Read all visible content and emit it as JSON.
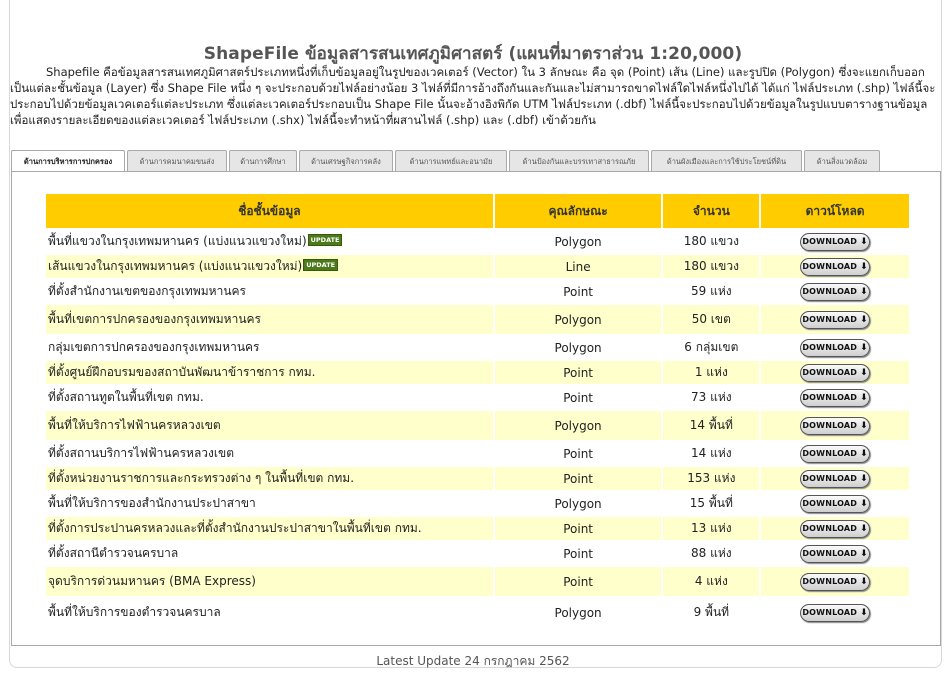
{
  "title": "ShapeFile ข้อมูลสารสนเทศภูมิศาสตร์ (แผนที่มาตราส่วน 1:20,000)",
  "intro": "Shapefile คือข้อมูลสารสนเทศภูมิศาสตร์ประเภทหนึ่งที่เก็บข้อมูลอยู่ในรูปของเวคเตอร์ (Vector) ใน 3 ลักษณะ คือ จุด (Point) เส้น (Line) และรูปปิด (Polygon) ซึ่งจะแยกเก็บออกเป็นแต่ละชั้นข้อมูล (Layer) ซึ่ง Shape File หนึ่ง ๆ จะประกอบด้วยไฟล์อย่างน้อย 3 ไฟล์ที่มีการอ้างถึงกันและกันและไม่สามารถขาดไฟล์ใดไฟล์หนึ่งไปได้ ได้แก่ ไฟล์ประเภท (.shp) ไฟล์นี้จะประกอบไปด้วยข้อมูลเวคเตอร์แต่ละประเภท ซึ่งแต่ละเวคเตอร์ประกอบเป็น Shape File นั้นจะอ้างอิงพิกัด UTM ไฟล์ประเภท (.dbf) ไฟล์นี้จะประกอบไปด้วยข้อมูลในรูปแบบตารางฐานข้อมูลเพื่อแสดงรายละเอียดของแต่ละเวคเตอร์ ไฟล์ประเภท (.shx) ไฟล์นี้จะทำหน้าที่ผสานไฟล์ (.shp) และ (.dbf) เข้าด้วยกัน",
  "tabs": [
    {
      "label": "ด้านการบริหารการปกครอง",
      "active": true
    },
    {
      "label": "ด้านการคมนาคมขนส่ง"
    },
    {
      "label": "ด้านการศึกษา"
    },
    {
      "label": "ด้านเศรษฐกิจการคลัง"
    },
    {
      "label": "ด้านการแพทย์และอนามัย"
    },
    {
      "label": "ด้านป้องกันและบรรเทาสาธารณภัย"
    },
    {
      "label": "ด้านผังเมืองและการใช้ประโยชน์ที่ดิน"
    },
    {
      "label": "ด้านสิ่งแวดล้อม"
    }
  ],
  "table": {
    "headers": [
      "ชื่อชั้นข้อมูล",
      "คุณลักษณะ",
      "จำนวน",
      "ดาวน์โหลด"
    ],
    "badge_text": "UPDATE",
    "download_label": "DOWNLOAD",
    "rows": [
      {
        "name": "พื้นที่แขวงในกรุงเทพมหานคร (แบ่งแนวแขวงใหม่)",
        "type": "Polygon",
        "count": "180 แขวง",
        "badge": true
      },
      {
        "name": "เส้นแขวงในกรุงเทพมหานคร (แบ่งแนวแขวงใหม่)",
        "type": "Line",
        "count": "180 แขวง",
        "badge": true
      },
      {
        "name": "ที่ตั้งสำนักงานเขตของกรุงเทพมหานคร",
        "type": "Point",
        "count": "59 แห่ง"
      },
      {
        "name": "พื้นที่เขตการปกครองของกรุงเทพมหานคร",
        "type": "Polygon",
        "count": "50 เขต",
        "tall": true
      },
      {
        "name": "กลุ่มเขตการปกครองของกรุงเทพมหานคร",
        "type": "Polygon",
        "count": "6 กลุ่มเขต"
      },
      {
        "name": "ที่ตั้งศูนย์ฝึกอบรมของสถาบันพัฒนาข้าราชการ กทม.",
        "type": "Point",
        "count": "1 แห่ง"
      },
      {
        "name": "ที่ตั้งสถานทูตในพื้นที่เขต กทม.",
        "type": "Point",
        "count": "73 แห่ง"
      },
      {
        "name": "พื้นที่ให้บริการไฟฟ้านครหลวงเขต",
        "type": "Polygon",
        "count": "14 พื้นที่",
        "tall": true
      },
      {
        "name": "ที่ตั้งสถานบริการไฟฟ้านครหลวงเขต",
        "type": "Point",
        "count": "14 แห่ง"
      },
      {
        "name": "ที่ตั้งหน่วยงานราชการและกระทรวงต่าง ๆ ในพื้นที่เขต กทม.",
        "type": "Point",
        "count": "153 แห่ง"
      },
      {
        "name": "พื้นที่ให้บริการของสำนักงานประปาสาขา",
        "type": "Polygon",
        "count": "15 พื้นที่"
      },
      {
        "name": "ที่ตั้งการประปานครหลวงและที่ตั้งสำนักงานประปาสาขาในพื้นที่เขต กทม.",
        "type": "Point",
        "count": "13 แห่ง"
      },
      {
        "name": "ที่ตั้งสถานีตำรวจนครบาล",
        "type": "Point",
        "count": "88 แห่ง"
      },
      {
        "name": "จุดบริการด่วนมหานคร (BMA Express)",
        "type": "Point",
        "count": "4 แห่ง",
        "tall": true
      },
      {
        "name": "พื้นที่ให้บริการของตำรวจนครบาล",
        "type": "Polygon",
        "count": "9 พื้นที่",
        "tall": true
      }
    ]
  },
  "footer": "Latest Update 24 กรกฎาคม 2562"
}
